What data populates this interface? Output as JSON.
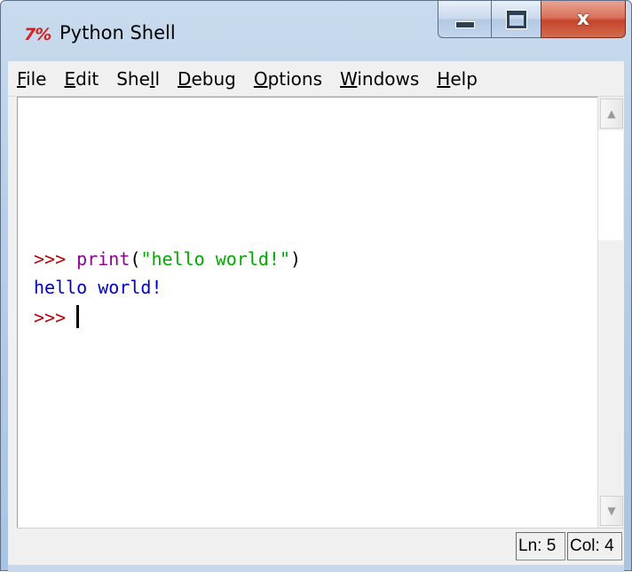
{
  "window": {
    "title": "Python Shell",
    "app_icon_text": "7%",
    "controls": {
      "minimize": "minimize",
      "maximize": "maximize",
      "close": "x"
    }
  },
  "menu": {
    "items": [
      {
        "label": "File",
        "accel": "F",
        "rest": "ile"
      },
      {
        "label": "Edit",
        "accel": "E",
        "rest": "dit"
      },
      {
        "label": "Shell",
        "pre": "She",
        "accel": "l",
        "rest": "l"
      },
      {
        "label": "Debug",
        "accel": "D",
        "rest": "ebug"
      },
      {
        "label": "Options",
        "accel": "O",
        "rest": "ptions"
      },
      {
        "label": "Windows",
        "accel": "W",
        "rest": "indows"
      },
      {
        "label": "Help",
        "accel": "H",
        "rest": "elp"
      }
    ]
  },
  "shell": {
    "line1": {
      "prompt": ">>> ",
      "keyword": "print",
      "paren_open": "(",
      "string": "\"hello world!\"",
      "paren_close": ")"
    },
    "line2": {
      "output": "hello world!"
    },
    "line3": {
      "prompt": ">>> "
    }
  },
  "status": {
    "ln": "Ln: 5",
    "col": "Col: 4"
  },
  "colors": {
    "prompt": "#c00000",
    "keyword": "#900090",
    "string": "#00aa00",
    "output": "#0000c0",
    "close_button": "#c3452b"
  }
}
